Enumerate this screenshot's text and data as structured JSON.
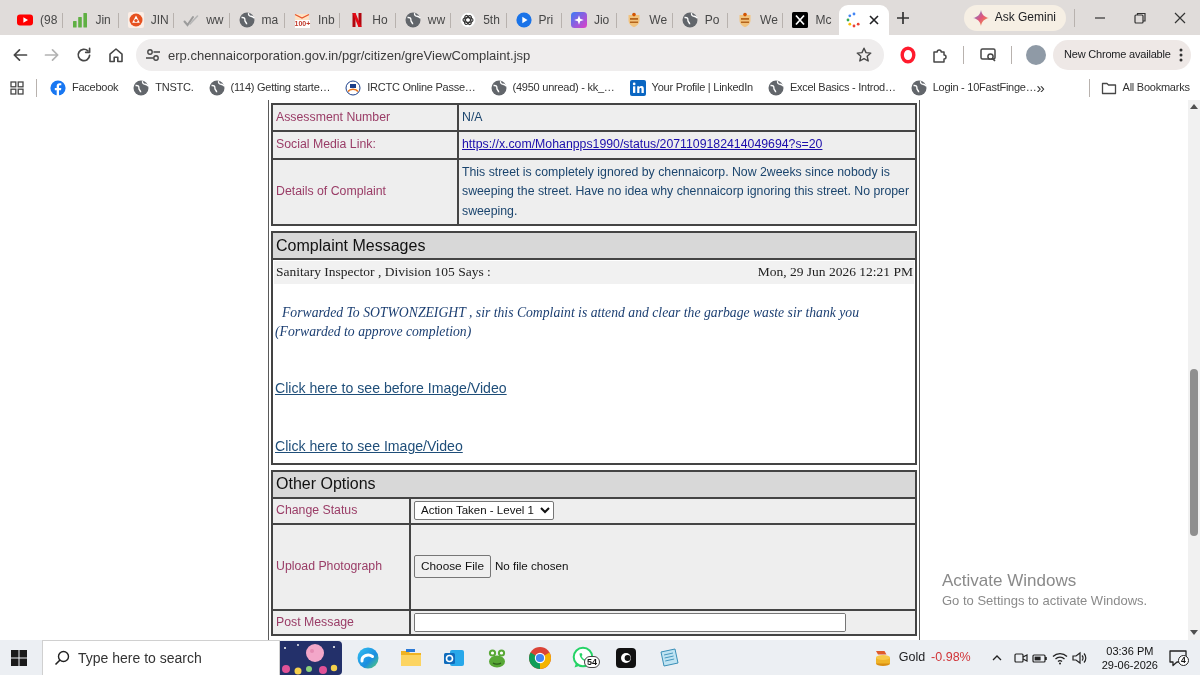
{
  "browser": {
    "tabs": [
      {
        "label": "(98",
        "selected": false
      },
      {
        "label": "Jin",
        "selected": false
      },
      {
        "label": "JIN",
        "selected": false
      },
      {
        "label": "ww",
        "selected": false
      },
      {
        "label": "ma",
        "selected": false
      },
      {
        "label": "Inb",
        "icon_badge": "100+",
        "selected": false
      },
      {
        "label": "Ho",
        "selected": false
      },
      {
        "label": "ww",
        "selected": false
      },
      {
        "label": "5th",
        "selected": false
      },
      {
        "label": "Pri",
        "selected": false
      },
      {
        "label": "Jio",
        "selected": false
      },
      {
        "label": "We",
        "selected": false
      },
      {
        "label": "Po",
        "selected": false
      },
      {
        "label": "We",
        "selected": false
      },
      {
        "label": "Mc",
        "selected": false
      },
      {
        "selected": true
      }
    ],
    "ask_button": "Ask Gemini",
    "forward_disabled": true,
    "address": "erp.chennaicorporation.gov.in/pgr/citizen/greViewComplaint.jsp",
    "update_button": "New Chrome available"
  },
  "bookmarks": {
    "items": [
      "Facebook",
      "TNSTC.",
      "(114) Getting starte…",
      "IRCTC Online Passe…",
      "(4950 unread) - kk_…",
      "Your Profile | LinkedIn",
      "Excel Basics - Introd…",
      "Login - 10FastFinge…"
    ],
    "more": "»",
    "all": "All Bookmarks"
  },
  "complaint_details": [
    {
      "kind": "text",
      "label": "Assessment Number",
      "value": "N/A"
    },
    {
      "kind": "link",
      "label": "Social Media Link:",
      "value": "https://x.com/Mohanpps1990/status/2071109182414049694?s=20"
    },
    {
      "kind": "text",
      "label": "Details of Complaint",
      "value": "This street is completely ignored by chennaicorp. Now 2weeks since nobody is sweeping the street. Have no idea why chennaicorp ignoring this street. No proper sweeping."
    }
  ],
  "complaint_messages": {
    "title": "Complaint Messages",
    "messages": [
      {
        "author": "Sanitary Inspector , Division 105 Says :",
        "date": "Mon, 29 Jun 2026 12:21 PM",
        "text": "Forwarded To SOTWONZEIGHT , sir this Complaint is attend and clear the garbage waste sir thank you",
        "note": "(Forwarded to approve completion)"
      }
    ],
    "links": [
      "Click here to see before Image/Video",
      "Click here to see Image/Video"
    ]
  },
  "other_options": {
    "title": "Other Options",
    "rows": [
      {
        "kind": "select",
        "label": "Change Status",
        "value": "Action Taken - Level 1"
      },
      {
        "kind": "file",
        "label": "Upload Photograph",
        "button": "Choose File",
        "value": "No file chosen"
      },
      {
        "kind": "textarea",
        "label": "Post Message"
      }
    ]
  },
  "activation_notice": {
    "title": "Activate Windows",
    "text": "Go to Settings to activate Windows."
  },
  "taskbar": {
    "search_placeholder": "Type here to search",
    "chat_badge": "54",
    "ticker": {
      "label": "Gold",
      "change": "-0.98%"
    },
    "time": "03:36 PM",
    "date": "29-06-2026",
    "notification_count": "4"
  }
}
